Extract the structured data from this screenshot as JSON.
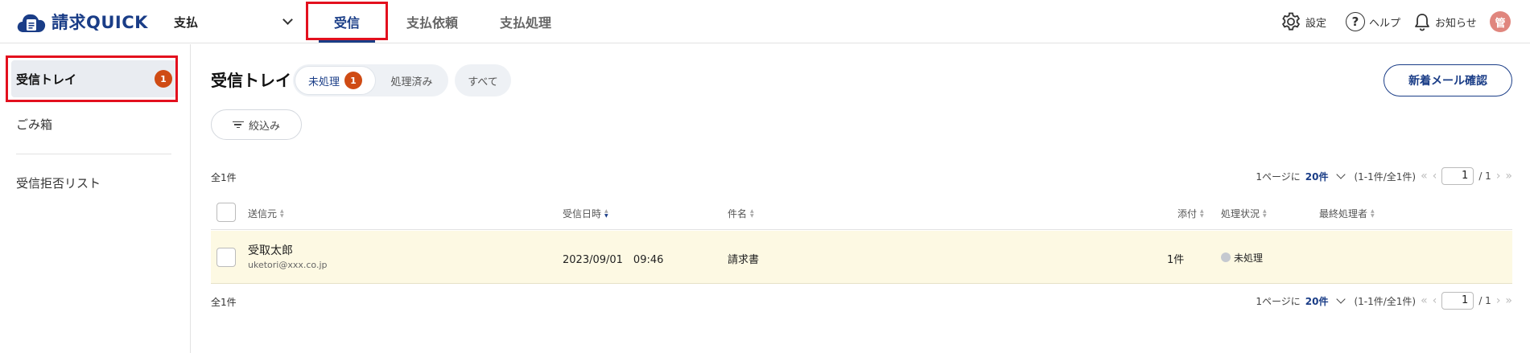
{
  "app": {
    "name": "請求QUICK"
  },
  "header": {
    "module": "支払",
    "tabs": [
      {
        "label": "受信",
        "active": true
      },
      {
        "label": "支払依頼"
      },
      {
        "label": "支払処理"
      }
    ],
    "settings": "設定",
    "help": "ヘルプ",
    "help_glyph": "?",
    "notice": "お知らせ",
    "avatar": "管"
  },
  "sidebar": {
    "items": [
      {
        "label": "受信トレイ",
        "badge": "1"
      },
      {
        "label": "ごみ箱"
      },
      {
        "label": "受信拒否リスト"
      }
    ]
  },
  "main": {
    "title": "受信トレイ",
    "filters": {
      "unprocessed": "未処理",
      "unprocessed_badge": "1",
      "processed": "処理済み",
      "all": "すべて"
    },
    "new_mail_button": "新着メール確認",
    "narrow_button": "絞込み",
    "total": "全1件",
    "pager": {
      "per_page_prefix": "1ページに",
      "per_page_value": "20件",
      "range": "(1-1件/全1件)",
      "first": "«",
      "prev": "‹",
      "next": "›",
      "last": "»",
      "current": "1",
      "of_total": "/ 1"
    },
    "columns": {
      "sender": "送信元",
      "received_at": "受信日時",
      "subject": "件名",
      "attachments": "添付",
      "status": "処理状況",
      "last_handler": "最終処理者"
    },
    "rows": [
      {
        "sender_name": "受取太郎",
        "sender_email": "uketori@xxx.co.jp",
        "received_at": "2023/09/01　09:46",
        "subject": "請求書",
        "attachments": "1件",
        "status": "未処理",
        "last_handler": ""
      }
    ]
  },
  "colors": {
    "brand": "#1a3d87",
    "badge": "#cf4b14",
    "highlight_box": "#e3101e",
    "row_bg": "#fdf9e3"
  }
}
